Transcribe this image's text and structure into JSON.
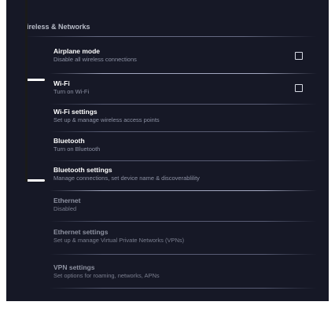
{
  "section": {
    "header": "ireless & Networks"
  },
  "items": [
    {
      "title": "Airplane mode",
      "subtitle": "Disable all wireless connections",
      "checkbox": true,
      "enabled": true
    },
    {
      "title": "Wi-Fi",
      "subtitle": "Turn on Wi-Fi",
      "checkbox": true,
      "enabled": true
    },
    {
      "title": "Wi-Fi settings",
      "subtitle": "Set up & manage wireless access points",
      "checkbox": false,
      "enabled": true
    },
    {
      "title": "Bluetooth",
      "subtitle": "Turn on Bluetooth",
      "checkbox": false,
      "enabled": true
    },
    {
      "title": "Bluetooth settings",
      "subtitle": "Manage connections, set device name & discoverablility",
      "checkbox": false,
      "enabled": true
    },
    {
      "title": "Ethernet",
      "subtitle": "Disabled",
      "checkbox": false,
      "enabled": false
    },
    {
      "title": "Ethernet settings",
      "subtitle": "Set up & manage Virtual Private Networks (VPNs)",
      "checkbox": false,
      "enabled": false
    },
    {
      "title": "VPN settings",
      "subtitle": "Set options for roaming, networks, APNs",
      "checkbox": false,
      "enabled": false
    }
  ],
  "colors": {
    "background": "#161826",
    "title_text": "#ffffff",
    "subtitle_text": "#8c91a3",
    "annotation_bracket": "#ffffff"
  }
}
